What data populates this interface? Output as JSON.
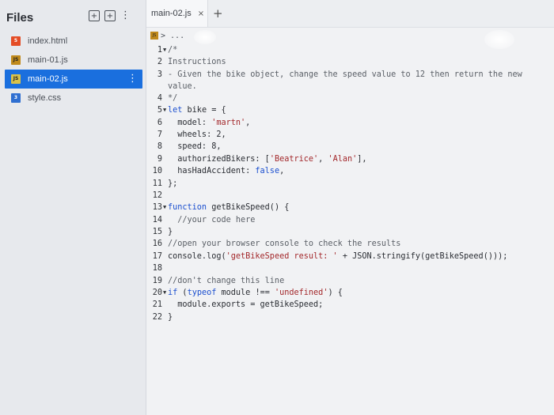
{
  "sidebar": {
    "title": "Files",
    "tools": [
      "new-file-icon",
      "new-folder-icon",
      "kebab-icon"
    ],
    "files": [
      {
        "name": "index.html",
        "icon": "html5-icon",
        "badge": "5",
        "active": false
      },
      {
        "name": "main-01.js",
        "icon": "js-icon",
        "badge": "JS",
        "active": false
      },
      {
        "name": "main-02.js",
        "icon": "js-icon",
        "badge": "JS",
        "active": true
      },
      {
        "name": "style.css",
        "icon": "css3-icon",
        "badge": "3",
        "active": false
      }
    ]
  },
  "editor": {
    "tab": {
      "label": "main-02.js",
      "close": "×"
    },
    "add_tab": "+",
    "breadcrumb": {
      "badge": "JS",
      "path": "> ..."
    },
    "lines": [
      {
        "n": "1",
        "fold": "▼",
        "text": "/*"
      },
      {
        "n": "2",
        "fold": "",
        "text": "Instructions"
      },
      {
        "n": "3",
        "fold": "",
        "text": "- Given the bike object, change the speed value to 12 then return the new value."
      },
      {
        "n": "4",
        "fold": "",
        "text": "*/"
      },
      {
        "n": "5",
        "fold": "▼",
        "text": "let bike = {"
      },
      {
        "n": "6",
        "fold": "",
        "text": "  model: 'martn',"
      },
      {
        "n": "7",
        "fold": "",
        "text": "  wheels: 2,"
      },
      {
        "n": "8",
        "fold": "",
        "text": "  speed: 8,"
      },
      {
        "n": "9",
        "fold": "",
        "text": "  authorizedBikers: ['Beatrice', 'Alan'],"
      },
      {
        "n": "10",
        "fold": "",
        "text": "  hasHadAccident: false,"
      },
      {
        "n": "11",
        "fold": "",
        "text": "};"
      },
      {
        "n": "12",
        "fold": "",
        "text": ""
      },
      {
        "n": "13",
        "fold": "▼",
        "text": "function getBikeSpeed() {"
      },
      {
        "n": "14",
        "fold": "",
        "text": "  //your code here"
      },
      {
        "n": "15",
        "fold": "",
        "text": "}"
      },
      {
        "n": "16",
        "fold": "",
        "text": "//open your browser console to check the results"
      },
      {
        "n": "17",
        "fold": "",
        "text": "console.log('getBikeSpeed result: ' + JSON.stringify(getBikeSpeed()));"
      },
      {
        "n": "18",
        "fold": "",
        "text": ""
      },
      {
        "n": "19",
        "fold": "",
        "text": "//don't change this line"
      },
      {
        "n": "20",
        "fold": "▼",
        "text": "if (typeof module !== 'undefined') {"
      },
      {
        "n": "21",
        "fold": "",
        "text": "  module.exports = getBikeSpeed;"
      },
      {
        "n": "22",
        "fold": "",
        "text": "}"
      }
    ]
  },
  "colors": {
    "accent": "#1a6fde",
    "keyword": "#1b4fcf",
    "string": "#a3282b",
    "comment": "#5a5f66"
  }
}
